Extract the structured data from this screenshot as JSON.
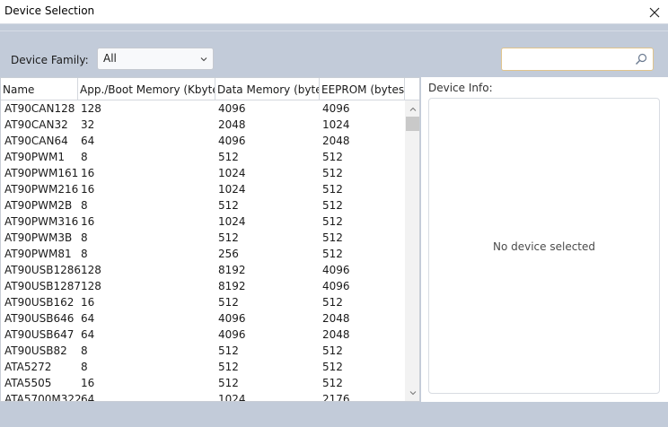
{
  "window": {
    "title": "Device Selection"
  },
  "filter": {
    "family_label": "Device Family:",
    "family_value": "All"
  },
  "search": {
    "placeholder": "",
    "value": ""
  },
  "table": {
    "columns": [
      "Name",
      "App./Boot Memory (Kbytes)",
      "Data Memory (bytes)",
      "EEPROM (bytes)"
    ],
    "rows": [
      [
        "AT90CAN128",
        "128",
        "4096",
        "4096"
      ],
      [
        "AT90CAN32",
        "32",
        "2048",
        "1024"
      ],
      [
        "AT90CAN64",
        "64",
        "4096",
        "2048"
      ],
      [
        "AT90PWM1",
        "8",
        "512",
        "512"
      ],
      [
        "AT90PWM161",
        "16",
        "1024",
        "512"
      ],
      [
        "AT90PWM216",
        "16",
        "1024",
        "512"
      ],
      [
        "AT90PWM2B",
        "8",
        "512",
        "512"
      ],
      [
        "AT90PWM316",
        "16",
        "1024",
        "512"
      ],
      [
        "AT90PWM3B",
        "8",
        "512",
        "512"
      ],
      [
        "AT90PWM81",
        "8",
        "256",
        "512"
      ],
      [
        "AT90USB1286",
        "128",
        "8192",
        "4096"
      ],
      [
        "AT90USB1287",
        "128",
        "8192",
        "4096"
      ],
      [
        "AT90USB162",
        "16",
        "512",
        "512"
      ],
      [
        "AT90USB646",
        "64",
        "4096",
        "2048"
      ],
      [
        "AT90USB647",
        "64",
        "4096",
        "2048"
      ],
      [
        "AT90USB82",
        "8",
        "512",
        "512"
      ],
      [
        "ATA5272",
        "8",
        "512",
        "512"
      ],
      [
        "ATA5505",
        "16",
        "512",
        "512"
      ],
      [
        "ATA5700M322",
        "64",
        "1024",
        "2176"
      ]
    ]
  },
  "info": {
    "label": "Device Info:",
    "empty_text": "No device selected"
  },
  "icons": {
    "close": "close-icon",
    "search": "search-icon",
    "dropdown": "chevron-down-icon",
    "scroll_up": "chevron-up-icon",
    "scroll_down": "chevron-down-icon"
  },
  "colors": {
    "background": "#c2cbd9",
    "search_border": "#e0c48c"
  }
}
